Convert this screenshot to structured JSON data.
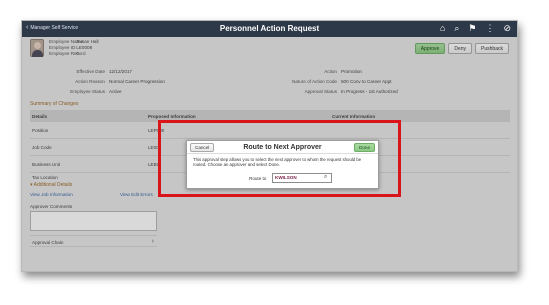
{
  "topbar": {
    "back_label": "Manager Self Service",
    "title": "Personnel Action Request",
    "icons": [
      "home-icon",
      "search-icon",
      "flag-icon",
      "menu-icon",
      "nav-circle-icon"
    ]
  },
  "employee": {
    "name_label": "Employee Name",
    "name": "Susan Hall",
    "id_label": "Employee ID",
    "id": "LE0008",
    "record_label": "Employee Record",
    "record": "0"
  },
  "actions": {
    "approve": "Approve",
    "deny": "Deny",
    "pushback": "Pushback"
  },
  "details_left": [
    {
      "label": "Effective Date",
      "value": "12/12/2017"
    },
    {
      "label": "Action Reason",
      "value": "Normal Career Progression"
    },
    {
      "label": "Employee Status",
      "value": "Active"
    }
  ],
  "details_right": [
    {
      "label": "Action",
      "value": "Promotion"
    },
    {
      "label": "Nature of Action Code",
      "value": "500  Conv to Career Appt"
    },
    {
      "label": "Approval Status",
      "value": "In Progress - 1st Authorized"
    }
  ],
  "summary": {
    "title": "Summary of Changes",
    "headers": [
      "Details",
      "Proposed Information",
      "Current Information"
    ],
    "rows": [
      {
        "detail": "Position",
        "proposed": "LEP000"
      },
      {
        "detail": "Job Code",
        "proposed": "LE004"
      },
      {
        "detail": "Business Unit",
        "proposed": "LEBU"
      },
      {
        "detail": "Tax Location",
        "proposed": ""
      }
    ]
  },
  "additional": {
    "title": "Additional Details",
    "view_job": "View Job Information",
    "view_edit": "View Edit Errors",
    "comments_label": "Approver Comments",
    "approval_chain": "Approval Chain"
  },
  "modal": {
    "cancel": "Cancel",
    "title": "Route to Next Approver",
    "done": "Done",
    "message": "This approval step allows you to select the next approver to whom the request should be routed. Choose an approver and select Done.",
    "route_label": "Route to",
    "route_value": "KWILSON"
  }
}
